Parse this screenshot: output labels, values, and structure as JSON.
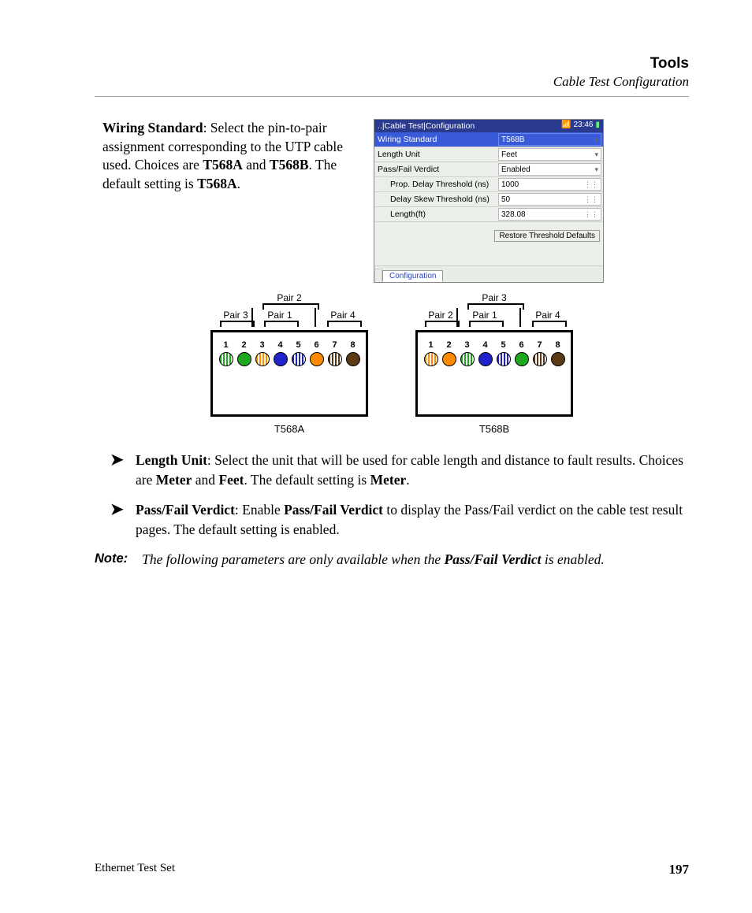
{
  "header": {
    "title": "Tools",
    "subtitle": "Cable Test Configuration"
  },
  "para1": {
    "lead": "Wiring Standard",
    "t1": ": Select the pin-to-pair assignment corresponding to the UTP cable used. Choices are ",
    "optA": "T568A",
    "and": " and ",
    "optB": "T568B",
    "t2": ". The default setting is ",
    "def": "T568A",
    "end": "."
  },
  "device": {
    "title": "..|Cable Test|Configuration",
    "clock": "23:46",
    "rows": [
      {
        "label": "Wiring Standard",
        "value": "T568B",
        "icon": "▾",
        "hi": true
      },
      {
        "label": "Length Unit",
        "value": "Feet",
        "icon": "▾"
      },
      {
        "label": "Pass/Fail Verdict",
        "value": "Enabled",
        "icon": "▾"
      },
      {
        "label": "Prop. Delay Threshold (ns)",
        "value": "1000",
        "icon": "⋮⋮",
        "indent": true
      },
      {
        "label": "Delay Skew Threshold (ns)",
        "value": "50",
        "icon": "⋮⋮",
        "indent": true
      },
      {
        "label": "Length(ft)",
        "value": "328.08",
        "icon": "⋮⋮",
        "indent": true
      }
    ],
    "button": "Restore Threshold Defaults",
    "tab": "Configuration"
  },
  "diagram": {
    "left": {
      "pairs": {
        "p1": "Pair 1",
        "p2": "Pair 2",
        "p3": "Pair 3",
        "p4": "Pair 4"
      },
      "label": "T568A"
    },
    "right": {
      "pairs": {
        "p1": "Pair 1",
        "p2": "Pair 2",
        "p3": "Pair 3",
        "p4": "Pair 4"
      },
      "label": "T568B"
    },
    "nums": [
      "1",
      "2",
      "3",
      "4",
      "5",
      "6",
      "7",
      "8"
    ]
  },
  "bullets": [
    {
      "lead": "Length Unit",
      "t1": ": Select the unit that will be used for cable length and distance to fault results. Choices are ",
      "o1": "Meter",
      "and": " and ",
      "o2": "Feet",
      "t2": ". The default setting is ",
      "def": "Meter",
      "end": "."
    },
    {
      "lead": "Pass/Fail Verdict",
      "t1": ": Enable ",
      "o1": "Pass/Fail Verdict",
      "t2": " to display the Pass/Fail verdict on the cable test result pages. The default setting is enabled."
    }
  ],
  "note": {
    "label": "Note:",
    "t1": "The following parameters are only available when the ",
    "b": "Pass/Fail Verdict",
    "t2": " is enabled."
  },
  "footer": {
    "product": "Ethernet Test Set",
    "page": "197"
  }
}
